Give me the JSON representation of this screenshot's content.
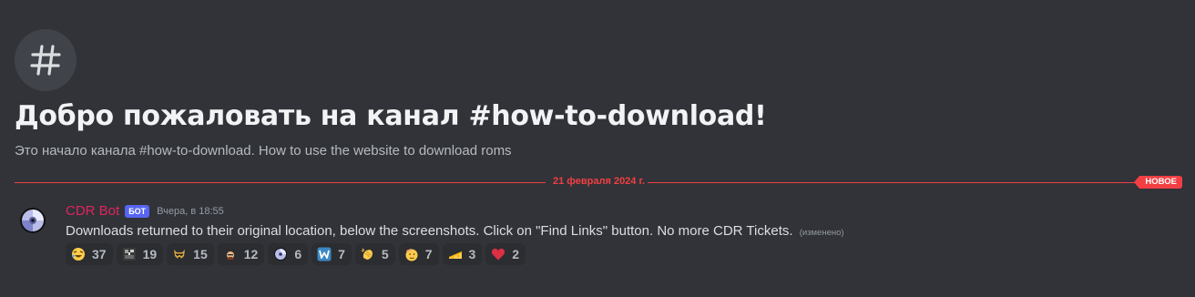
{
  "header": {
    "channel_glyph": "#",
    "title": "Добро пожаловать на канал #how-to-download!",
    "subtitle": "Это начало канала #how-to-download. How to use the website to download roms"
  },
  "divider": {
    "date": "21 февраля 2024 г.",
    "new_label": "НОВОЕ",
    "color": "#f23f43"
  },
  "message": {
    "author": "CDR Bot",
    "author_color": "#e0245e",
    "bot_tag": "БОТ",
    "timestamp": "Вчера, в 18:55",
    "text": "Downloads returned to their original location, below the screenshots. Click on \"Find Links\" button. No more CDR Tickets.",
    "edited": "(изменено)",
    "reactions": [
      {
        "icon": "laughing-face-icon",
        "count": "37"
      },
      {
        "icon": "pixel-art-icon",
        "count": "19"
      },
      {
        "icon": "dog-face-icon",
        "count": "15"
      },
      {
        "icon": "character-icon",
        "count": "12"
      },
      {
        "icon": "disc-icon",
        "count": "6"
      },
      {
        "icon": "letter-w-icon",
        "count": "7"
      },
      {
        "icon": "clapping-hands-icon",
        "count": "5"
      },
      {
        "icon": "saluting-face-icon",
        "count": "7"
      },
      {
        "icon": "cheese-icon",
        "count": "3"
      },
      {
        "icon": "red-heart-icon",
        "count": "2"
      }
    ]
  }
}
